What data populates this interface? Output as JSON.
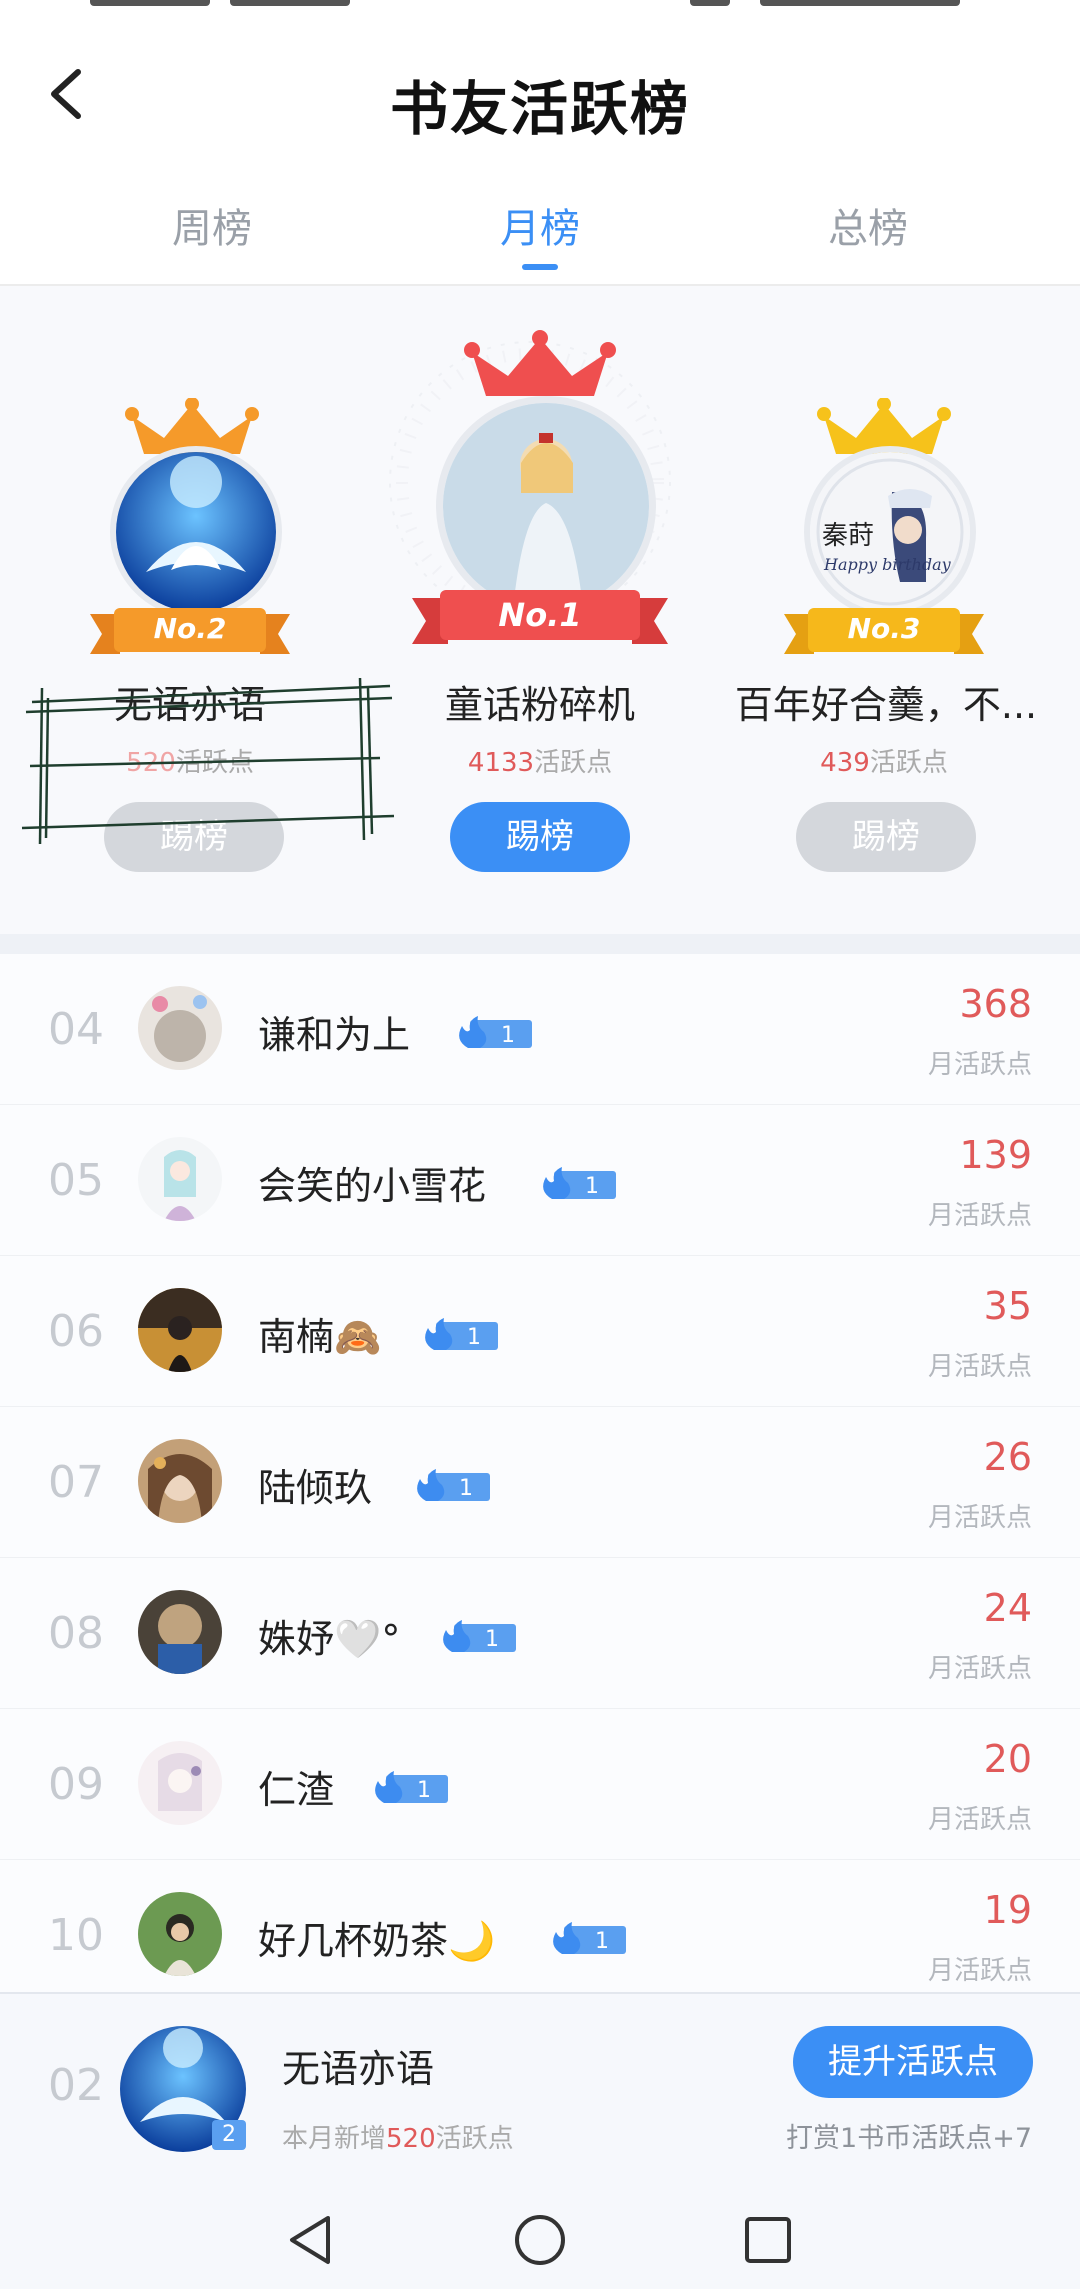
{
  "header": {
    "title": "书友活跃榜"
  },
  "tabs": [
    {
      "label": "周榜"
    },
    {
      "label": "月榜"
    },
    {
      "label": "总榜"
    }
  ],
  "podium": [
    {
      "rank_label": "No.2",
      "name": "无语亦语",
      "points": "520",
      "points_suffix": "活跃点",
      "button": "踢榜",
      "button_active": false
    },
    {
      "rank_label": "No.1",
      "name": "童话粉碎机",
      "points": "4133",
      "points_suffix": "活跃点",
      "button": "踢榜",
      "button_active": true
    },
    {
      "rank_label": "No.3",
      "name": "百年好合羹，不...",
      "points": "439",
      "points_suffix": "活跃点",
      "button": "踢榜",
      "button_active": false
    }
  ],
  "list": [
    {
      "rank": "04",
      "name": "谦和为上",
      "level": "1",
      "value": "368",
      "unit": "月活跃点"
    },
    {
      "rank": "05",
      "name": "会笑的小雪花",
      "level": "1",
      "value": "139",
      "unit": "月活跃点"
    },
    {
      "rank": "06",
      "name": "南楠🙈",
      "level": "1",
      "value": "35",
      "unit": "月活跃点"
    },
    {
      "rank": "07",
      "name": "陆倾玖",
      "level": "1",
      "value": "26",
      "unit": "月活跃点"
    },
    {
      "rank": "08",
      "name": "姝妤🤍°",
      "level": "1",
      "value": "24",
      "unit": "月活跃点"
    },
    {
      "rank": "09",
      "name": "仁渣",
      "level": "1",
      "value": "20",
      "unit": "月活跃点"
    },
    {
      "rank": "10",
      "name": "好几杯奶茶🌙",
      "level": "1",
      "value": "19",
      "unit": "月活跃点"
    }
  ],
  "mine": {
    "rank": "02",
    "name": "无语亦语",
    "level": "2",
    "sub_prefix": "本月新增",
    "sub_value": "520",
    "sub_suffix": "活跃点",
    "button": "提升活跃点",
    "tip": "打赏1书币活跃点+7"
  },
  "colors": {
    "accent": "#3b8ff5",
    "points": "#e05a5a",
    "gold_crown": "#f6b81b",
    "orange_crown": "#f59a2a",
    "red_ribbon": "#ef4f4f"
  }
}
